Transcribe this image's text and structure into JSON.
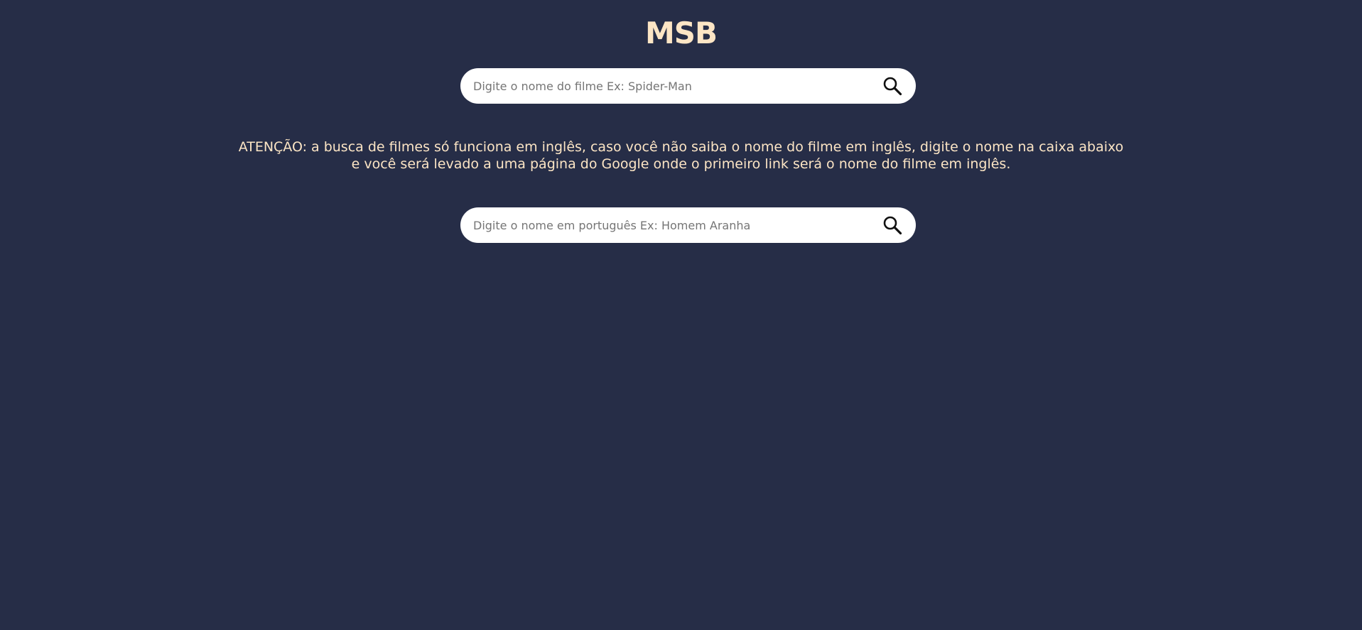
{
  "header": {
    "title": "MSB"
  },
  "english_search": {
    "placeholder": "Digite o nome do filme Ex: Spider-Man",
    "value": "",
    "button_icon": "search-icon"
  },
  "notice": {
    "line1": "ATENÇÃO: a busca de filmes só funciona em inglês, caso você não saiba o nome do filme em inglês, digite o nome na caixa abaixo",
    "line2": "e você será levado a uma página do Google onde o primeiro link será o nome do filme em inglês."
  },
  "portuguese_search": {
    "placeholder": "Digite o nome em português Ex: Homem Aranha",
    "value": "",
    "button_icon": "search-icon"
  },
  "colors": {
    "background": "#262d47",
    "accent_text": "#fce5c5",
    "input_background": "#ffffff"
  }
}
